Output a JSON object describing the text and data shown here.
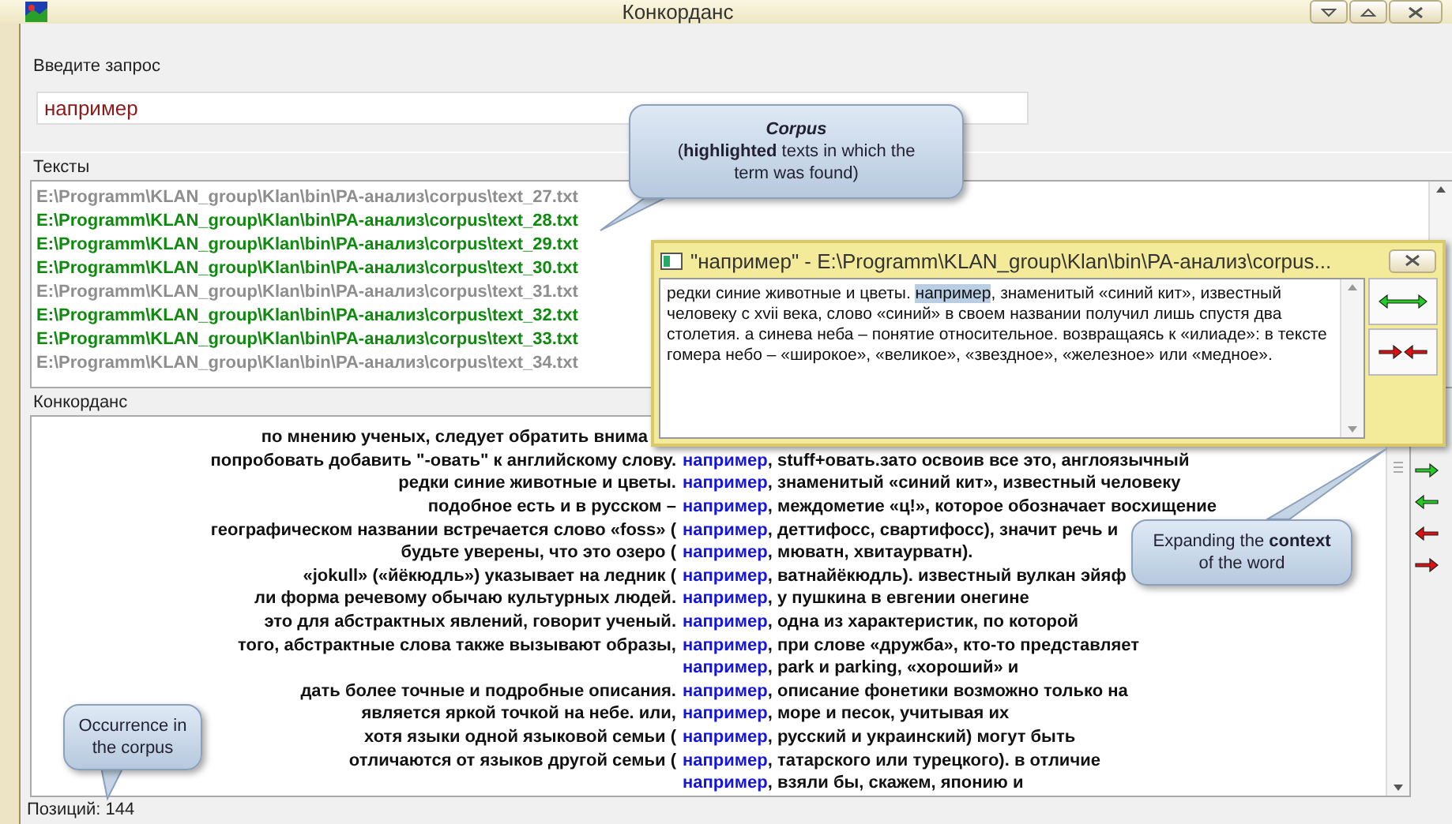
{
  "window": {
    "title": "Конкорданс"
  },
  "query": {
    "label": "Введите запрос",
    "value": "например"
  },
  "texts": {
    "label": "Тексты",
    "items": [
      {
        "path": "E:\\Programm\\KLAN_group\\Klan\\bin\\PA-анализ\\corpus\\text_27.txt",
        "highlighted": false
      },
      {
        "path": "E:\\Programm\\KLAN_group\\Klan\\bin\\PA-анализ\\corpus\\text_28.txt",
        "highlighted": true
      },
      {
        "path": "E:\\Programm\\KLAN_group\\Klan\\bin\\PA-анализ\\corpus\\text_29.txt",
        "highlighted": true
      },
      {
        "path": "E:\\Programm\\KLAN_group\\Klan\\bin\\PA-анализ\\corpus\\text_30.txt",
        "highlighted": true
      },
      {
        "path": "E:\\Programm\\KLAN_group\\Klan\\bin\\PA-анализ\\corpus\\text_31.txt",
        "highlighted": false
      },
      {
        "path": "E:\\Programm\\KLAN_group\\Klan\\bin\\PA-анализ\\corpus\\text_32.txt",
        "highlighted": true
      },
      {
        "path": "E:\\Programm\\KLAN_group\\Klan\\bin\\PA-анализ\\corpus\\text_33.txt",
        "highlighted": true
      },
      {
        "path": "E:\\Programm\\KLAN_group\\Klan\\bin\\PA-анализ\\corpus\\text_34.txt",
        "highlighted": false
      }
    ]
  },
  "concordance": {
    "label": "Конкорданс",
    "rows": [
      {
        "left": "по мнению ученых, следует обратить внима"
      },
      {
        "left": "попробовать добавить \"-овать\" к английскому слову.",
        "keyword": "например",
        "right": ", stuff+овать.зато освоив все это, англоязычный"
      },
      {
        "left": "редки синие животные и цветы.",
        "keyword": "например",
        "right": ", знаменитый «синий кит», известный человеку"
      },
      {
        "left": "подобное есть и в русском –",
        "keyword": "например",
        "right": ", междометие «ц!», которое обозначает восхищение"
      },
      {
        "left": "географическом названии встречается слово «foss» (",
        "keyword": "например",
        "right": ", деттифосс, свартифосс), значит речь и"
      },
      {
        "left": "будьте уверены, что это озеро (",
        "keyword": "например",
        "right": ", мюватн, хвитаурватн)."
      },
      {
        "left": "«jokull» («йёкюдль») указывает на ледник (",
        "keyword": "например",
        "right": ", ватнайёкюдль). известный вулкан эйяф"
      },
      {
        "left": "ли форма речевому обычаю культурных людей.",
        "keyword": "например",
        "right": ", у пушкина в евгении онегине"
      },
      {
        "left": "это для абстрактных явлений, говорит ученый.",
        "keyword": "например",
        "right": ", одна из характеристик, по которой"
      },
      {
        "left": "того, абстрактные слова также вызывают образы,",
        "keyword": "например",
        "right": ", при слове «дружба», кто-то представляет"
      },
      {
        "keyword": "например",
        "right": ", park и parking, «хороший» и"
      },
      {
        "left": "дать более точные и подробные описания.",
        "keyword": "например",
        "right": ", описание фонетики возможно только на"
      },
      {
        "left": "является яркой точкой на небе. или,",
        "keyword": "например",
        "right": ", море и песок, учитывая их"
      },
      {
        "left": "хотя языки одной языковой семьи (",
        "keyword": "например",
        "right": ", русский и украинский) могут быть"
      },
      {
        "left": "отличаются от языков другой семьи (",
        "keyword": "например",
        "right": ", татарского или турецкого). в отличие"
      },
      {
        "keyword": "например",
        "right": ", взяли бы, скажем, японию и"
      }
    ]
  },
  "context_window": {
    "title": "\"например\" - E:\\Programm\\KLAN_group\\Klan\\bin\\PA-анализ\\corpus...",
    "before": "редки синие животные и цветы. ",
    "selected": "например",
    "after": ", знаменитый «синий кит», известный человеку с xvii века, слово «синий» в своем названии получил лишь спустя два столетия. а синева неба – понятие относительное. возвращаясь к «илиаде»: в тексте гомера небо – «широкое», «великое», «звездное», «железное» или «медное»."
  },
  "callouts": [
    {
      "title": "Corpus",
      "text": "(**highlighted** texts in which the term was found)"
    },
    {
      "text": "Expanding the **context** of the word"
    },
    {
      "text": "Occurrence in the corpus"
    }
  ],
  "status": "Позиций: 144"
}
